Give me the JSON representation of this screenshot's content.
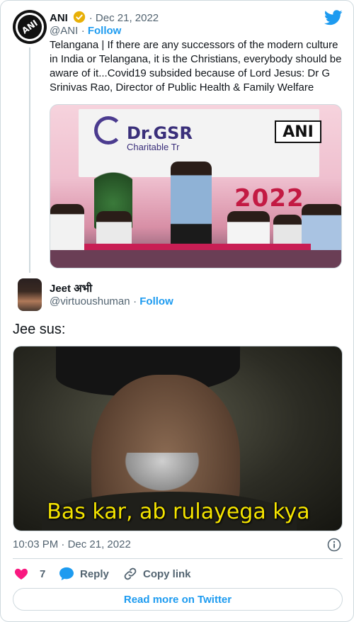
{
  "quoted_tweet": {
    "author_name": "ANI",
    "handle": "@ANI",
    "date": "Dec 21, 2022",
    "follow_label": "Follow",
    "text": "Telangana | If there are any successors of the modern culture in India or Telangana, it is the Christians, everybody should be aware of it...Covid19 subsided because of Lord Jesus: Dr G Srinivas Rao, Director of Public Health & Family Welfare",
    "media": {
      "banner_title": "Dr.GSR",
      "banner_subtitle": "Charitable Tr",
      "banner_year": "2022",
      "badge": "ANI"
    }
  },
  "tweet": {
    "author_name": "Jeet अभी",
    "handle": "@virtuoushuman",
    "follow_label": "Follow",
    "text": "Jee sus:",
    "media_caption": "Bas kar, ab rulayega kya",
    "time": "10:03 PM",
    "date": "Dec 21, 2022",
    "likes": "7",
    "reply_label": "Reply",
    "copy_link_label": "Copy link",
    "read_more_label": "Read more on Twitter"
  },
  "colors": {
    "accent": "#1d9bf0",
    "like": "#f91880",
    "verified": "#e8b007",
    "caption": "#f4e400"
  },
  "icons": [
    "twitter-bird-icon",
    "verified-badge-icon",
    "info-icon",
    "heart-icon",
    "reply-bubble-icon",
    "link-icon"
  ]
}
